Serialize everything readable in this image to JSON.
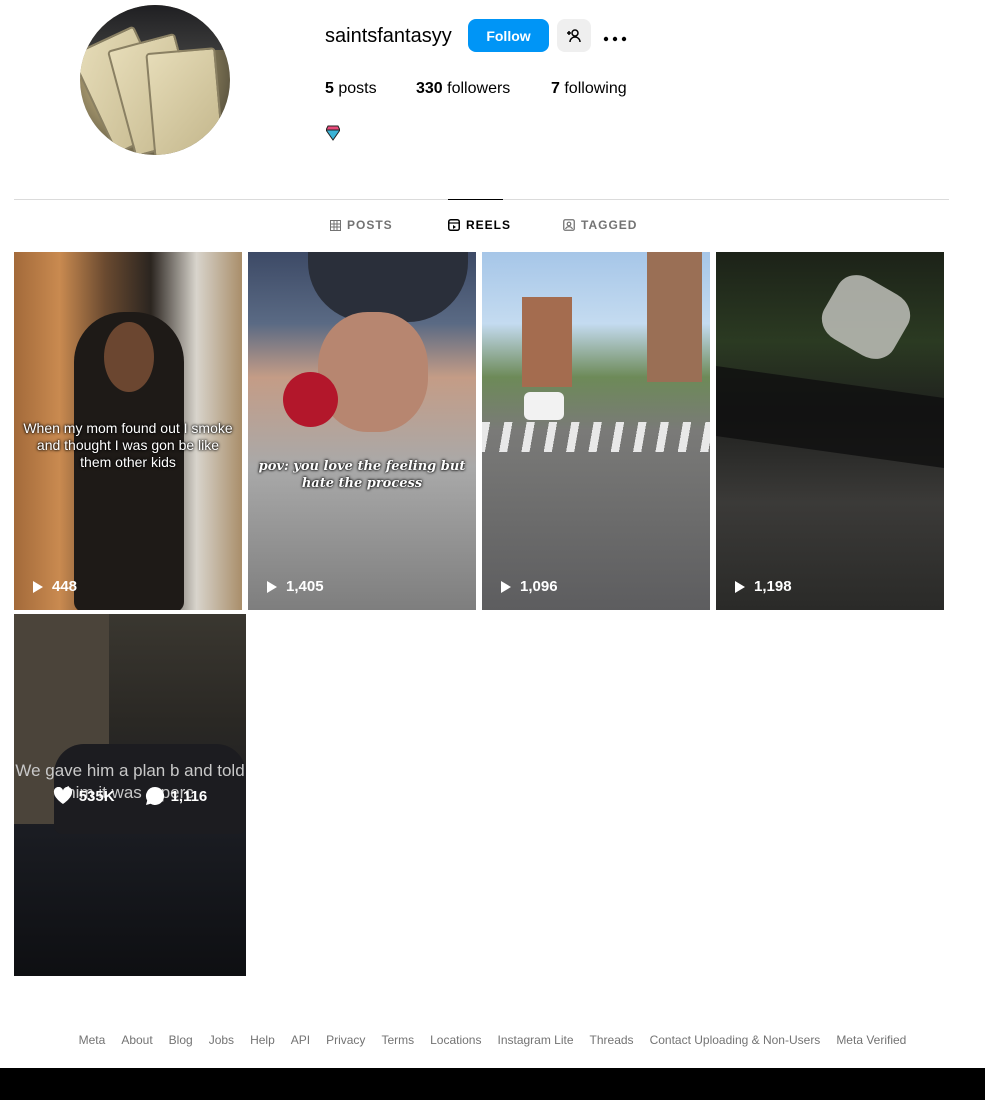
{
  "profile": {
    "username": "saintsfantasyy",
    "follow_label": "Follow",
    "stats": {
      "posts_count": "5",
      "posts_label": "posts",
      "followers_count": "330",
      "followers_label": "followers",
      "following_count": "7",
      "following_label": "following"
    }
  },
  "tabs": [
    {
      "label": "POSTS",
      "icon": "grid-icon",
      "active": false
    },
    {
      "label": "REELS",
      "icon": "reels-icon",
      "active": true
    },
    {
      "label": "TAGGED",
      "icon": "tagged-icon",
      "active": false
    }
  ],
  "reels": [
    {
      "caption": "When my mom found out I smoke and thought I was gon be like them other kids",
      "views": "448"
    },
    {
      "caption": "pov: you love the feeling but hate the process",
      "views": "1,405"
    },
    {
      "caption": "",
      "views": "1,096"
    },
    {
      "caption": "",
      "views": "1,198"
    },
    {
      "caption": "We gave him a plan b and told him it was a perc",
      "likes": "535K",
      "comments": "1,116"
    }
  ],
  "footer": {
    "links": [
      "Meta",
      "About",
      "Blog",
      "Jobs",
      "Help",
      "API",
      "Privacy",
      "Terms",
      "Locations",
      "Instagram Lite",
      "Threads",
      "Contact Uploading & Non-Users",
      "Meta Verified"
    ]
  },
  "colors": {
    "follow_button": "#0095f6",
    "secondary_button": "#efefef",
    "muted_text": "#737373"
  }
}
